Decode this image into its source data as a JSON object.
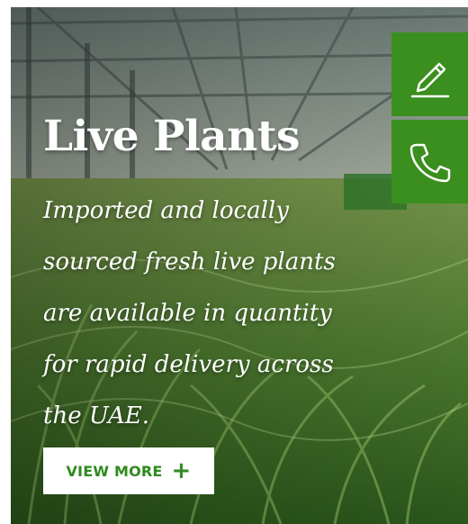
{
  "hero": {
    "title": "Live Plants",
    "description": "Imported and locally sourced fresh live plants are available in quantity for rapid delivery across the UAE.",
    "button_label": "VIEW MORE",
    "button_icon": "+"
  },
  "side_actions": [
    {
      "icon": "pencil-icon"
    },
    {
      "icon": "phone-icon"
    }
  ],
  "colors": {
    "accent_green": "#3a8f1e",
    "button_text": "#2e8b1f"
  }
}
